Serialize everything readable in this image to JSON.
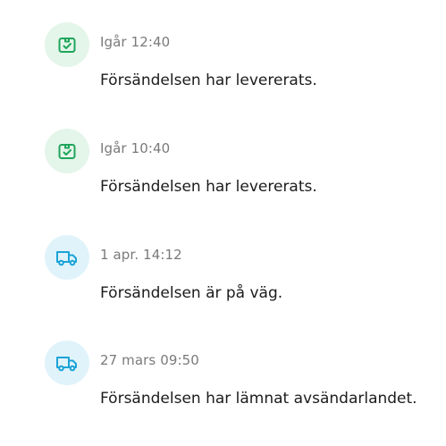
{
  "colors": {
    "delivered_icon": "#1fa55a",
    "delivered_bg": "#e4f5ea",
    "transit_icon": "#1ba3d6",
    "transit_bg": "#e0f3fb",
    "timestamp_text": "#7a7a7a",
    "message_text": "#1c1c1c"
  },
  "events": [
    {
      "icon": "package-check-icon",
      "status": "delivered",
      "timestamp": "Igår 12:40",
      "message": "Försändelsen har levererats."
    },
    {
      "icon": "package-check-icon",
      "status": "delivered",
      "timestamp": "Igår 10:40",
      "message": "Försändelsen har levererats."
    },
    {
      "icon": "truck-icon",
      "status": "transit",
      "timestamp": "1 apr. 14:12",
      "message": "Försändelsen är på väg."
    },
    {
      "icon": "truck-icon",
      "status": "transit",
      "timestamp": "27 mars 09:50",
      "message": "Försändelsen har lämnat avsändarlandet."
    }
  ]
}
